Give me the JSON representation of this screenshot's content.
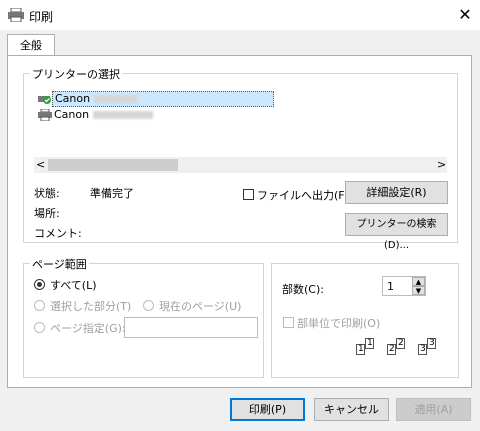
{
  "window": {
    "title": "印刷",
    "close_glyph": "✕"
  },
  "tab": {
    "label": "全般"
  },
  "printer_section": {
    "legend": "プリンターの選択",
    "printers": [
      {
        "name": "Canon",
        "selected": true,
        "icon": "printer-default-icon"
      },
      {
        "name": "Canon",
        "selected": false,
        "icon": "printer-icon"
      }
    ],
    "scroll_left": "<",
    "scroll_right": ">"
  },
  "status": {
    "state_label": "状態:",
    "state_value": "準備完了",
    "location_label": "場所:",
    "comment_label": "コメント:"
  },
  "print_to_file": {
    "label": "ファイルへ出力(F)",
    "checked": false
  },
  "buttons": {
    "details": "詳細設定(R)",
    "find_printer": "プリンターの検索(D)...",
    "print": "印刷(P)",
    "cancel": "キャンセル",
    "apply": "適用(A)"
  },
  "page_range": {
    "legend": "ページ範囲",
    "all": "すべて(L)",
    "selection": "選択した部分(T)",
    "current": "現在のページ(U)",
    "pages": "ページ指定(G):"
  },
  "copies": {
    "label": "部数(C):",
    "value": "1",
    "collate": "部単位で印刷(O)",
    "page_numbers": [
      "1",
      "1",
      "2",
      "2",
      "3",
      "3"
    ]
  }
}
